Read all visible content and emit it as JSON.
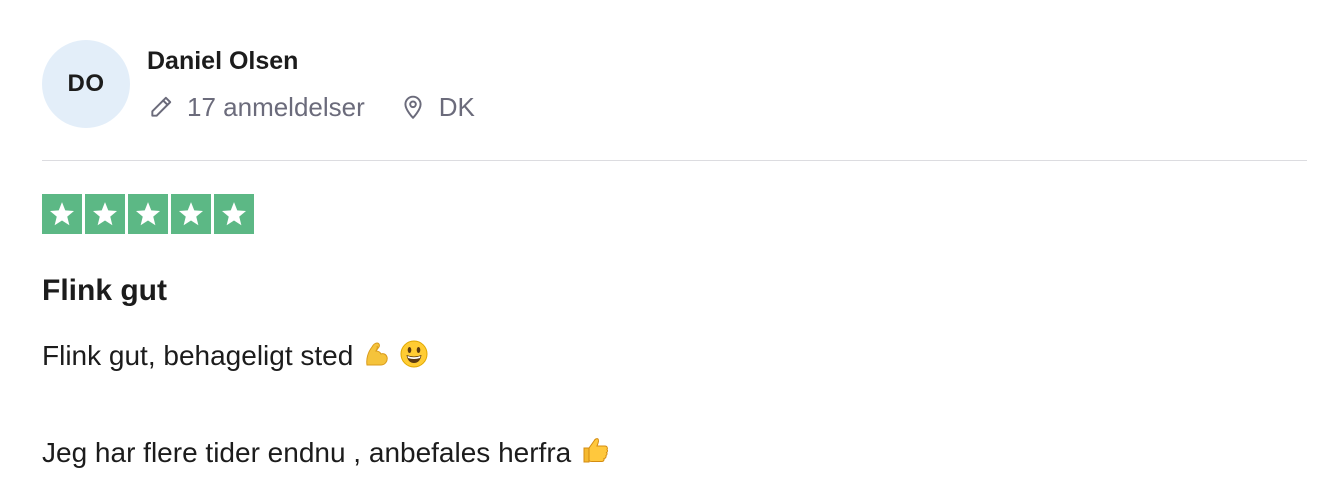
{
  "reviewer": {
    "initials": "DO",
    "name": "Daniel Olsen",
    "reviews_count": "17 anmeldelser",
    "country": "DK",
    "avatar_bg": "#e3eef9"
  },
  "rating": {
    "stars": 5,
    "max": 5,
    "color": "#5cb885",
    "icons": [
      "star-icon",
      "star-icon",
      "star-icon",
      "star-icon",
      "star-icon"
    ]
  },
  "review": {
    "title": "Flink gut",
    "line1": "Flink gut, behageligt sted",
    "line1_emojis": [
      "flexed-biceps-icon",
      "grinning-face-icon"
    ],
    "line2": "Jeg har flere tider endnu , anbefales herfra",
    "line2_emojis": [
      "thumbs-up-icon"
    ]
  },
  "icons": {
    "reviews": "pencil-icon",
    "location": "location-pin-icon"
  }
}
